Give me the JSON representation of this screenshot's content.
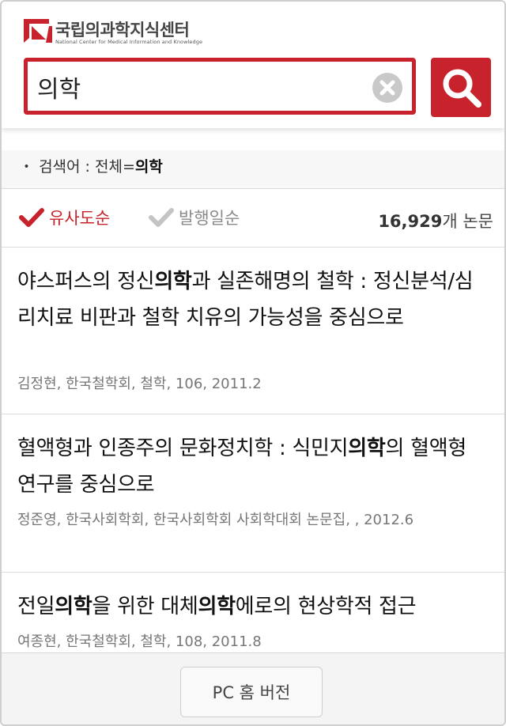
{
  "header": {
    "logo_name": "국립의과학지식센터",
    "logo_sub": "National Center for Medical Information and Knowledge"
  },
  "search": {
    "value": "의학",
    "placeholder": ""
  },
  "query": {
    "bullet": "・",
    "label": "검색어 : 전체=",
    "term": "의학"
  },
  "sort": {
    "active_label": "유사도순",
    "inactive_label": "발행일순",
    "count_number": "16,929",
    "count_suffix": "개 논문"
  },
  "results": [
    {
      "title_parts": [
        "야스퍼스의 정신",
        "의학",
        "과 실존해명의 철학 : 정신분석/심리치료 비판과 철학 치유의 가능성을 중심으로"
      ],
      "meta": "김정현, 한국철학회, 철학, 106, 2011.2"
    },
    {
      "title_parts": [
        "혈액형과 인종주의 문화정치학 : 식민지",
        "의학",
        "의 혈액형 연구를 중심으로"
      ],
      "meta": "정준영, 한국사회학회, 한국사회학회 사회학대회 논문집, , 2012.6"
    },
    {
      "title_parts": [
        "전일",
        "의학",
        "을 위한 대체",
        "의학",
        "에로의 현상학적 접근"
      ],
      "meta": "여종현, 한국철학회, 철학, 108, 2011.8"
    }
  ],
  "footer": {
    "pc_button": "PC 홈 버전"
  },
  "colors": {
    "accent": "#c8232c",
    "muted": "#8a8a8a"
  },
  "icons": {
    "logo": "nckm-logo-icon",
    "clear": "clear-icon",
    "search": "search-icon",
    "check_active": "check-icon",
    "check_inactive": "check-icon"
  }
}
